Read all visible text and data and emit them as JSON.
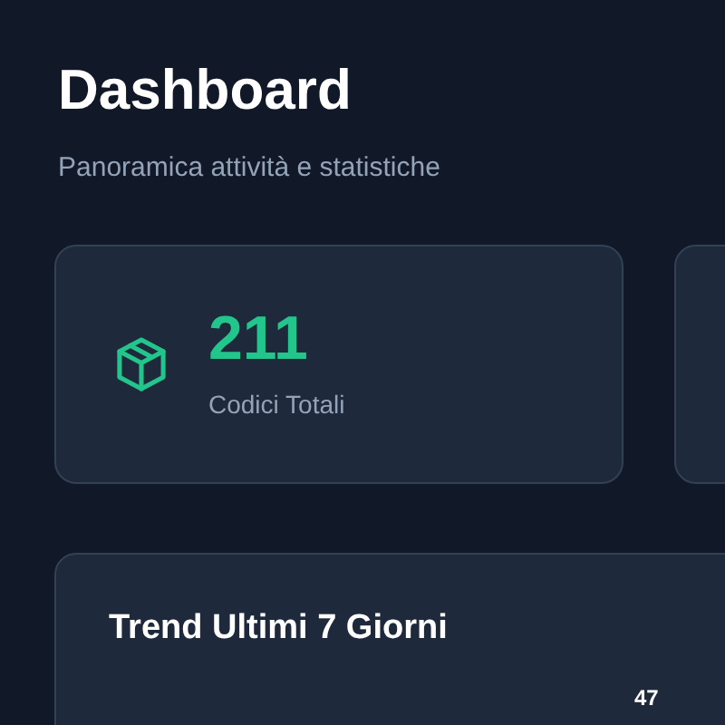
{
  "header": {
    "title": "Dashboard",
    "subtitle": "Panoramica attività e statistiche"
  },
  "stats": [
    {
      "kind": "box",
      "value": "211",
      "label": "Codici Totali"
    }
  ],
  "trend": {
    "title": "Trend Ultimi 7 Giorni",
    "value_label": "47"
  }
}
